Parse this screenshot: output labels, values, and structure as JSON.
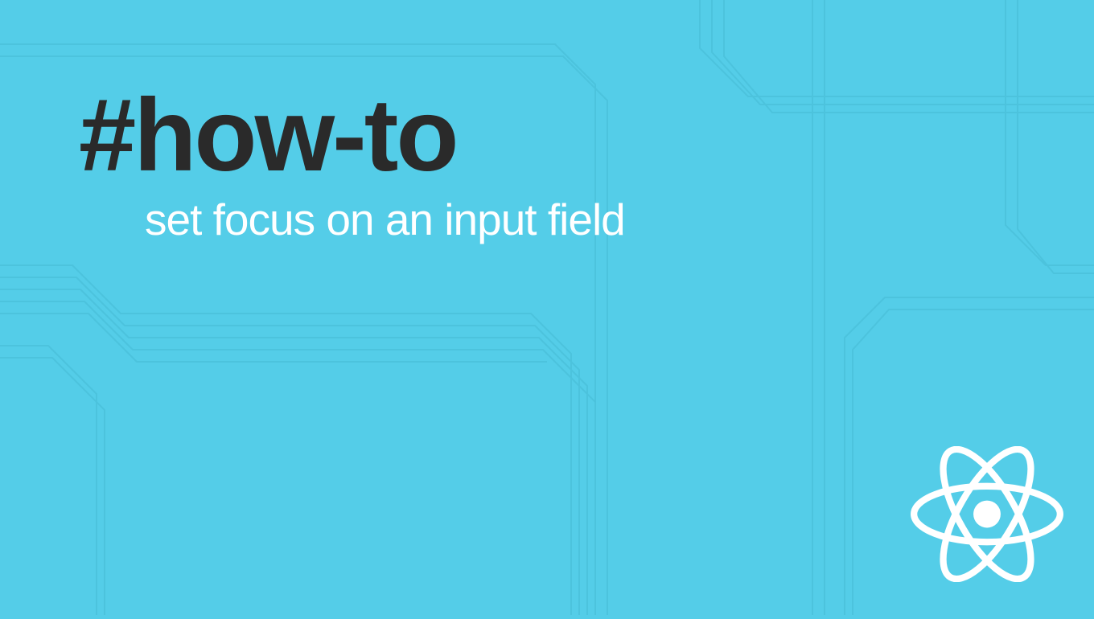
{
  "title": "#how-to",
  "subtitle": "set focus on an input field",
  "colors": {
    "background": "#54cde8",
    "title_text": "#2a2a2a",
    "subtitle_text": "#ffffff",
    "logo": "#ffffff",
    "circuit_line": "#4cc3dd"
  },
  "logo_name": "react"
}
